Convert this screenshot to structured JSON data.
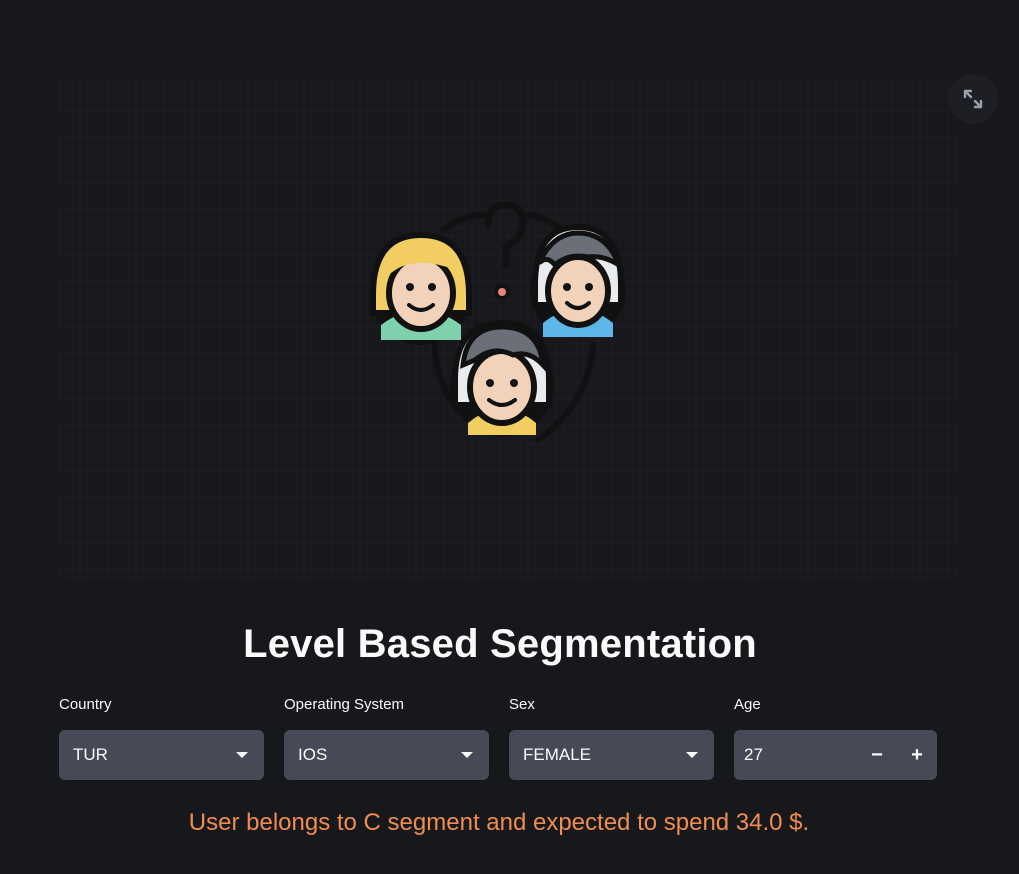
{
  "page": {
    "title": "Level Based Segmentation",
    "result": "User belongs to C segment and expected to spend 34.0 $."
  },
  "hero": {
    "fullscreen_icon": "expand-arrows-icon",
    "illustration_icon": "people-question-icon"
  },
  "fields": {
    "country": {
      "label": "Country",
      "value": "TUR"
    },
    "os": {
      "label": "Operating System",
      "value": "IOS"
    },
    "sex": {
      "label": "Sex",
      "value": "FEMALE"
    },
    "age": {
      "label": "Age",
      "value": "27",
      "decrement": "−",
      "increment": "+"
    }
  },
  "colors": {
    "background": "#16181c",
    "input_bg": "#454a56",
    "result_text": "#f08c4e",
    "text": "#fafafa"
  }
}
